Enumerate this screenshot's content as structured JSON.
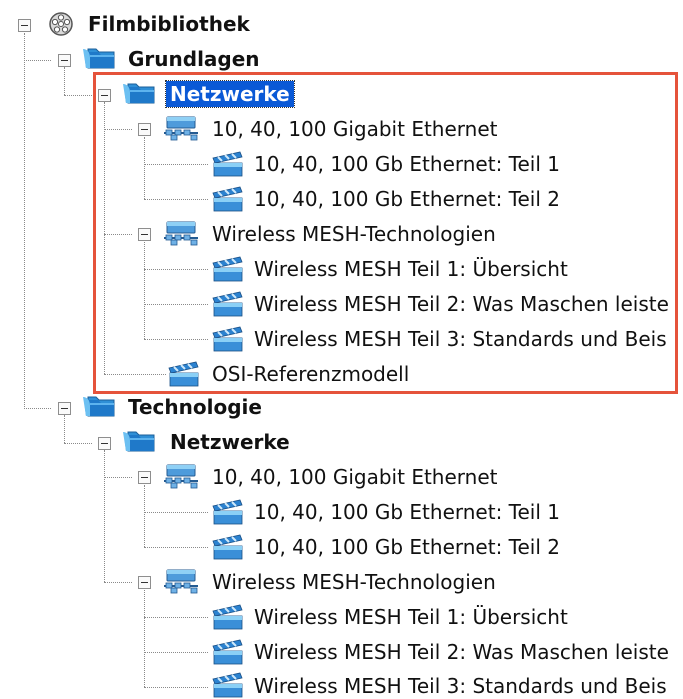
{
  "colors": {
    "highlight_border": "#e5533b",
    "selection": "#0a59d6"
  },
  "tree": {
    "root": {
      "label": "Filmbibliothek",
      "icon": "film-reel-icon"
    },
    "grundlagen": {
      "label": "Grundlagen",
      "netzwerke": {
        "label": "Netzwerke",
        "selected": true,
        "gigabit": {
          "label": "10, 40, 100 Gigabit Ethernet",
          "items": [
            "10, 40, 100 Gb Ethernet: Teil 1",
            "10, 40, 100 Gb Ethernet: Teil 2"
          ]
        },
        "wireless": {
          "label": "Wireless MESH-Technologien",
          "items": [
            "Wireless MESH Teil 1: Übersicht",
            "Wireless MESH Teil 2: Was Maschen leiste",
            "Wireless MESH Teil 3: Standards und Beis"
          ]
        },
        "osi": "OSI-Referenzmodell"
      }
    },
    "technologie": {
      "label": "Technologie",
      "netzwerke": {
        "label": "Netzwerke",
        "gigabit": {
          "label": "10, 40, 100 Gigabit Ethernet",
          "items": [
            "10, 40, 100 Gb Ethernet: Teil 1",
            "10, 40, 100 Gb Ethernet: Teil 2"
          ]
        },
        "wireless": {
          "label": "Wireless MESH-Technologien",
          "items": [
            "Wireless MESH Teil 1: Übersicht",
            "Wireless MESH Teil 2: Was Maschen leiste",
            "Wireless MESH Teil 3: Standards und Beis"
          ]
        }
      }
    }
  }
}
